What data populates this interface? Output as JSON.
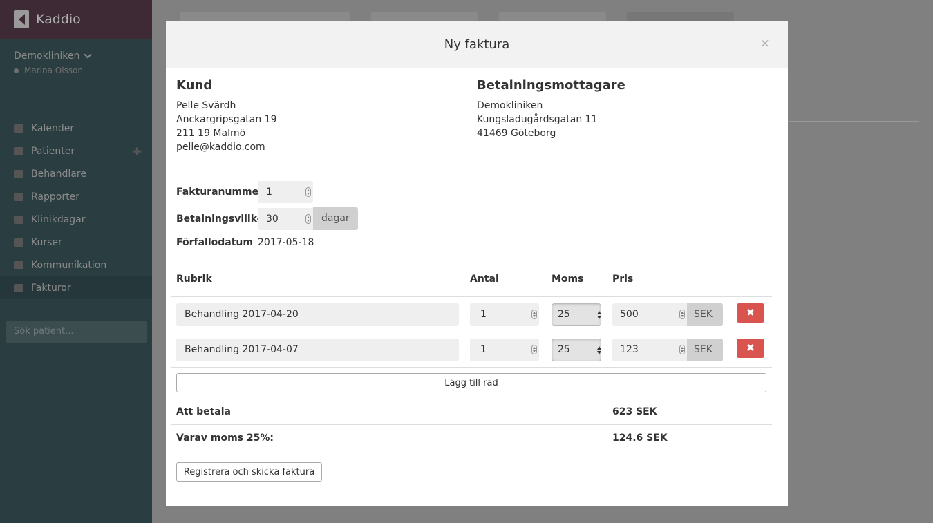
{
  "app": {
    "name": "Kaddio",
    "clinic": "Demokliniken",
    "user": "Marina Olsson"
  },
  "sidebar": {
    "items": [
      {
        "label": "Kalender",
        "icon": "calendar-icon"
      },
      {
        "label": "Patienter",
        "icon": "users-icon"
      },
      {
        "label": "Behandlare",
        "icon": "user-icon"
      },
      {
        "label": "Rapporter",
        "icon": "bar-chart-icon"
      },
      {
        "label": "Klinikdagar",
        "icon": "calendar-icon"
      },
      {
        "label": "Kurser",
        "icon": "graduation-cap-icon"
      },
      {
        "label": "Kommunikation",
        "icon": "chat-icon"
      },
      {
        "label": "Fakturor",
        "icon": "file-icon"
      }
    ],
    "active": "Fakturor",
    "search_placeholder": "Sök patient..."
  },
  "modal": {
    "title": "Ny faktura",
    "close_glyph": "×",
    "customer": {
      "heading": "Kund",
      "name": "Pelle Svärdh",
      "street": "Anckargripsgatan 19",
      "city": "211 19 Malmö",
      "email": "pelle@kaddio.com"
    },
    "payee": {
      "heading": "Betalningsmottagare",
      "name": "Demokliniken",
      "street": "Kungsladugårdsgatan 11",
      "city": "41469 Göteborg"
    },
    "invoice_number": {
      "label": "Fakturanummer",
      "value": "1"
    },
    "payment_terms": {
      "label": "Betalningsvillkor",
      "value": "30",
      "unit": "dagar"
    },
    "due_date": {
      "label": "Förfallodatum",
      "value": "2017-05-18"
    },
    "table": {
      "headers": {
        "rubrik": "Rubrik",
        "antal": "Antal",
        "moms": "Moms",
        "pris": "Pris"
      },
      "rows": [
        {
          "rubrik": "Behandling 2017-04-20",
          "antal": "1",
          "moms": "25",
          "pris": "500",
          "currency": "SEK",
          "delete_glyph": "✖"
        },
        {
          "rubrik": "Behandling 2017-04-07",
          "antal": "1",
          "moms": "25",
          "pris": "123",
          "currency": "SEK",
          "delete_glyph": "✖"
        }
      ],
      "add_row_label": "Lägg till rad"
    },
    "totals": {
      "to_pay_label": "Att betala",
      "to_pay_value": "623 SEK",
      "vat_label": "Varav moms 25%:",
      "vat_value": "124.6 SEK"
    },
    "submit_label": "Registrera och skicka faktura"
  },
  "colors": {
    "danger": "#d9534f",
    "sidebar_bg": "#2a3d41",
    "brand_bg": "#3d2a35"
  }
}
